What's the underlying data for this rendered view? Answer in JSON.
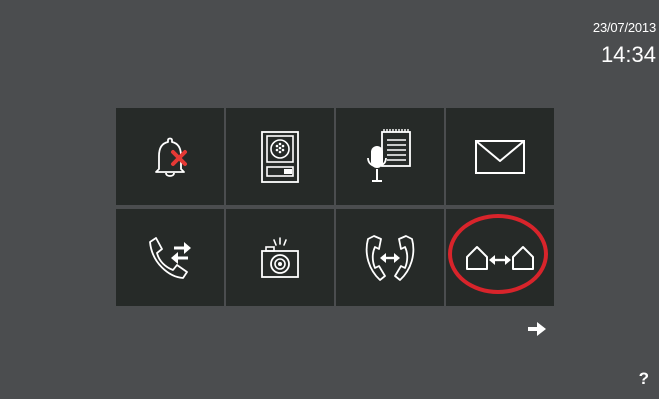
{
  "status": {
    "date": "23/07/2013",
    "time": "14:34"
  },
  "menu": {
    "tiles": [
      {
        "icon": "doorbell-mute-icon",
        "function": "mute-doorbell"
      },
      {
        "icon": "entrance-panel-icon",
        "function": "entrance-panel"
      },
      {
        "icon": "voice-memo-icon",
        "function": "voice-messages"
      },
      {
        "icon": "envelope-icon",
        "function": "messages"
      },
      {
        "icon": "call-transfer-icon",
        "function": "call-transfer"
      },
      {
        "icon": "camera-icon",
        "function": "photos"
      },
      {
        "icon": "intercom-call-icon",
        "function": "intercom"
      },
      {
        "icon": "house-to-house-icon",
        "function": "house-intercom"
      }
    ],
    "highlighted_tile": "house-to-house-icon"
  },
  "footer": {
    "next_icon": "arrow-right-icon",
    "help_label": "?"
  },
  "colors": {
    "background": "#4b4d4f",
    "tile": "#262a28",
    "highlight": "#d8242b",
    "mute_mark": "#e53935"
  }
}
